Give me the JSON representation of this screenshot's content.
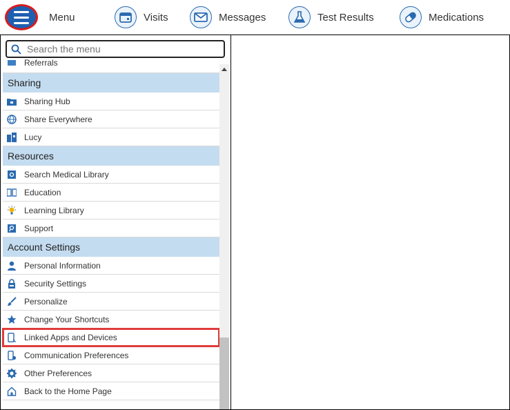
{
  "nav": {
    "menu_label": "Menu",
    "items": [
      {
        "label": "Visits"
      },
      {
        "label": "Messages"
      },
      {
        "label": "Test Results"
      },
      {
        "label": "Medications"
      }
    ]
  },
  "search": {
    "placeholder": "Search the menu"
  },
  "sidebar": {
    "partial_item": "Referrals",
    "sections": [
      {
        "title": "Sharing",
        "items": [
          "Sharing Hub",
          "Share Everywhere",
          "Lucy"
        ]
      },
      {
        "title": "Resources",
        "items": [
          "Search Medical Library",
          "Education",
          "Learning Library",
          "Support"
        ]
      },
      {
        "title": "Account Settings",
        "items": [
          "Personal Information",
          "Security Settings",
          "Personalize",
          "Change Your Shortcuts",
          "Linked Apps and Devices",
          "Communication Preferences",
          "Other Preferences",
          "Back to the Home Page"
        ]
      }
    ]
  },
  "colors": {
    "accent": "#1e5fb0",
    "section_bg": "#c4dcf0",
    "highlight": "#e03b3b"
  }
}
